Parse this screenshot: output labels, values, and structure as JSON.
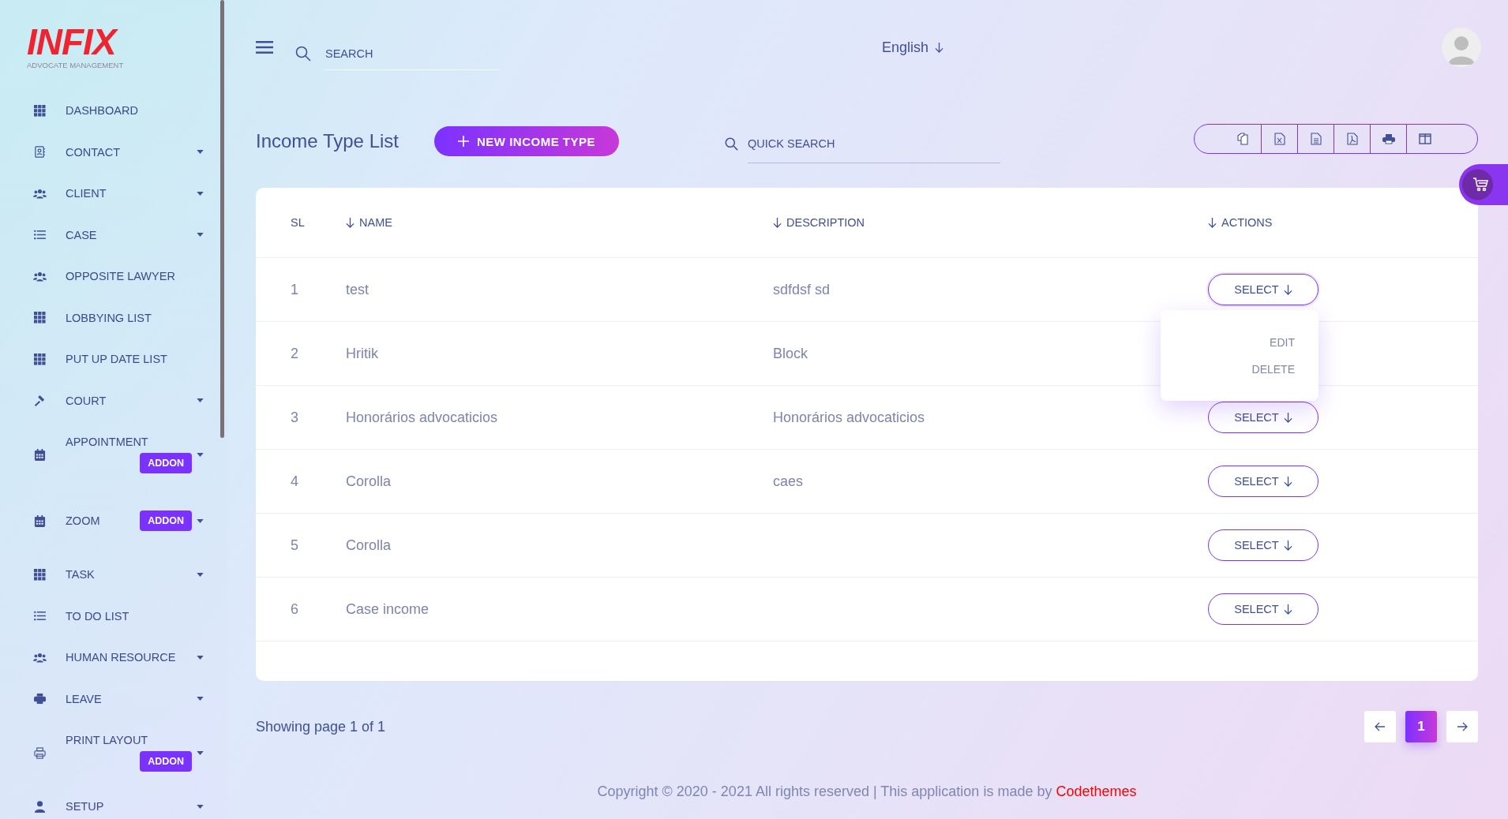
{
  "logo": {
    "brand": "INFIX",
    "tagline": "ADVOCATE MANAGEMENT"
  },
  "sidebar": {
    "items": [
      {
        "label": "DASHBOARD",
        "has_submenu": false
      },
      {
        "label": "CONTACT",
        "has_submenu": true
      },
      {
        "label": "CLIENT",
        "has_submenu": true
      },
      {
        "label": "CASE",
        "has_submenu": true
      },
      {
        "label": "OPPOSITE LAWYER",
        "has_submenu": false
      },
      {
        "label": "LOBBYING LIST",
        "has_submenu": false
      },
      {
        "label": "PUT UP DATE LIST",
        "has_submenu": false
      },
      {
        "label": "COURT",
        "has_submenu": true
      },
      {
        "label": "APPOINTMENT",
        "has_submenu": true,
        "badge": "ADDON"
      },
      {
        "label": "ZOOM",
        "has_submenu": true,
        "badge": "ADDON"
      },
      {
        "label": "TASK",
        "has_submenu": true
      },
      {
        "label": "TO DO LIST",
        "has_submenu": false
      },
      {
        "label": "HUMAN RESOURCE",
        "has_submenu": true
      },
      {
        "label": "LEAVE",
        "has_submenu": true
      },
      {
        "label": "PRINT LAYOUT",
        "has_submenu": true,
        "badge": "ADDON"
      },
      {
        "label": "SETUP",
        "has_submenu": true
      }
    ]
  },
  "header": {
    "search": {
      "placeholder": "SEARCH"
    },
    "language": "English"
  },
  "page": {
    "title": "Income Type List",
    "new_button": "NEW INCOME TYPE",
    "quick_search": {
      "placeholder": "QUICK SEARCH"
    }
  },
  "table": {
    "columns": [
      {
        "label": "SL",
        "sortable": false
      },
      {
        "label": "NAME",
        "sortable": true
      },
      {
        "label": "DESCRIPTION",
        "sortable": true
      },
      {
        "label": "ACTIONS",
        "sortable": true
      }
    ],
    "rows": [
      {
        "sl": "1",
        "name": "test",
        "description": "sdfdsf sd",
        "action": "SELECT",
        "expanded": true,
        "menu": [
          "EDIT",
          "DELETE"
        ]
      },
      {
        "sl": "2",
        "name": "Hritik",
        "description": "Block",
        "expanded": false
      },
      {
        "sl": "3",
        "name": "Honorários advocaticios",
        "description": "Honorários advocaticios",
        "action": "SELECT",
        "expanded": false
      },
      {
        "sl": "4",
        "name": "Corolla",
        "description": "caes",
        "action": "SELECT",
        "expanded": false
      },
      {
        "sl": "5",
        "name": "Corolla",
        "action": "SELECT",
        "expanded": false
      },
      {
        "sl": "6",
        "name": "Case income",
        "action": "SELECT",
        "expanded": false
      }
    ]
  },
  "pagination": {
    "summary": "Showing page 1 of 1",
    "pages": [
      {
        "label": "1",
        "selected": true
      }
    ]
  },
  "footer": {
    "text": "Copyright © 2020 - 2021 All rights reserved | This application is made by",
    "link": "Codethemes"
  }
}
